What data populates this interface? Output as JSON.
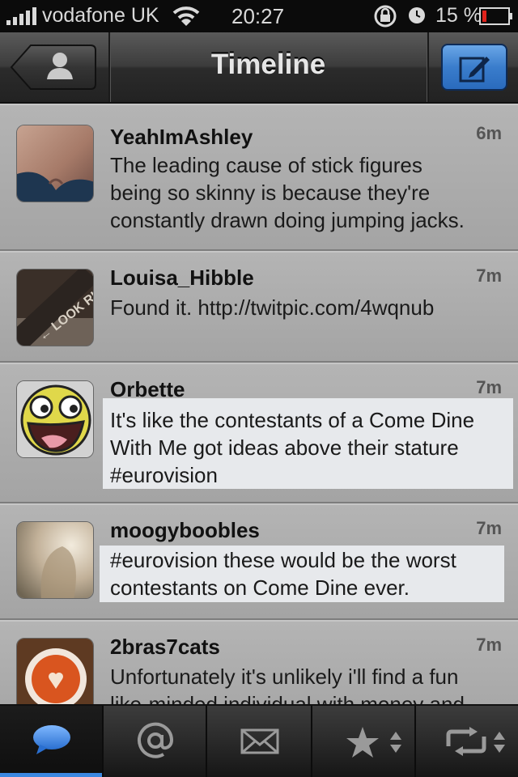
{
  "status_bar": {
    "carrier": "vodafone UK",
    "time": "20:27",
    "battery": "15 %"
  },
  "nav": {
    "title": "Timeline"
  },
  "tweets": [
    {
      "user": "YeahImAshley",
      "age": "6m",
      "text": "The leading cause of stick figures being so skinny is because they're constantly drawn doing jumping jacks.",
      "lines": [
        "The leading cause of stick figures",
        "being so skinny is because they're",
        "constantly drawn doing jumping jacks."
      ]
    },
    {
      "user": "Louisa_Hibble",
      "age": "7m",
      "text": "Found it. http://twitpic.com/4wqnub",
      "lines": [
        "Found it. http://twitpic.com/4wqnub"
      ],
      "avatar_text": "← LOOK RIGH"
    },
    {
      "user": "Orbette",
      "age": "7m",
      "text": "It's like the contestants of a Come Dine With Me got ideas above their stature #eurovision",
      "lines": [
        "It's like the contestants of a Come Dine",
        "With Me got ideas above their stature",
        "#eurovision"
      ]
    },
    {
      "user": "moogyboobles",
      "age": "7m",
      "text": "#eurovision  these would be the worst contestants on Come Dine ever.",
      "lines": [
        "#eurovision  these would be the worst",
        "contestants on Come Dine ever."
      ]
    },
    {
      "user": "2bras7cats",
      "age": "7m",
      "text": "Unfortunately it's unlikely i'll find a fun like-minded individual with money and",
      "lines": [
        "Unfortunately it's unlikely i'll find a fun",
        "like-minded individual with money and"
      ]
    }
  ],
  "tabs": [
    "timeline",
    "mentions",
    "messages",
    "favorites",
    "retweets"
  ],
  "colors": {
    "accent": "#3b88e0",
    "highlight": "#e7e9ec",
    "cell": "#aaaaaa"
  }
}
